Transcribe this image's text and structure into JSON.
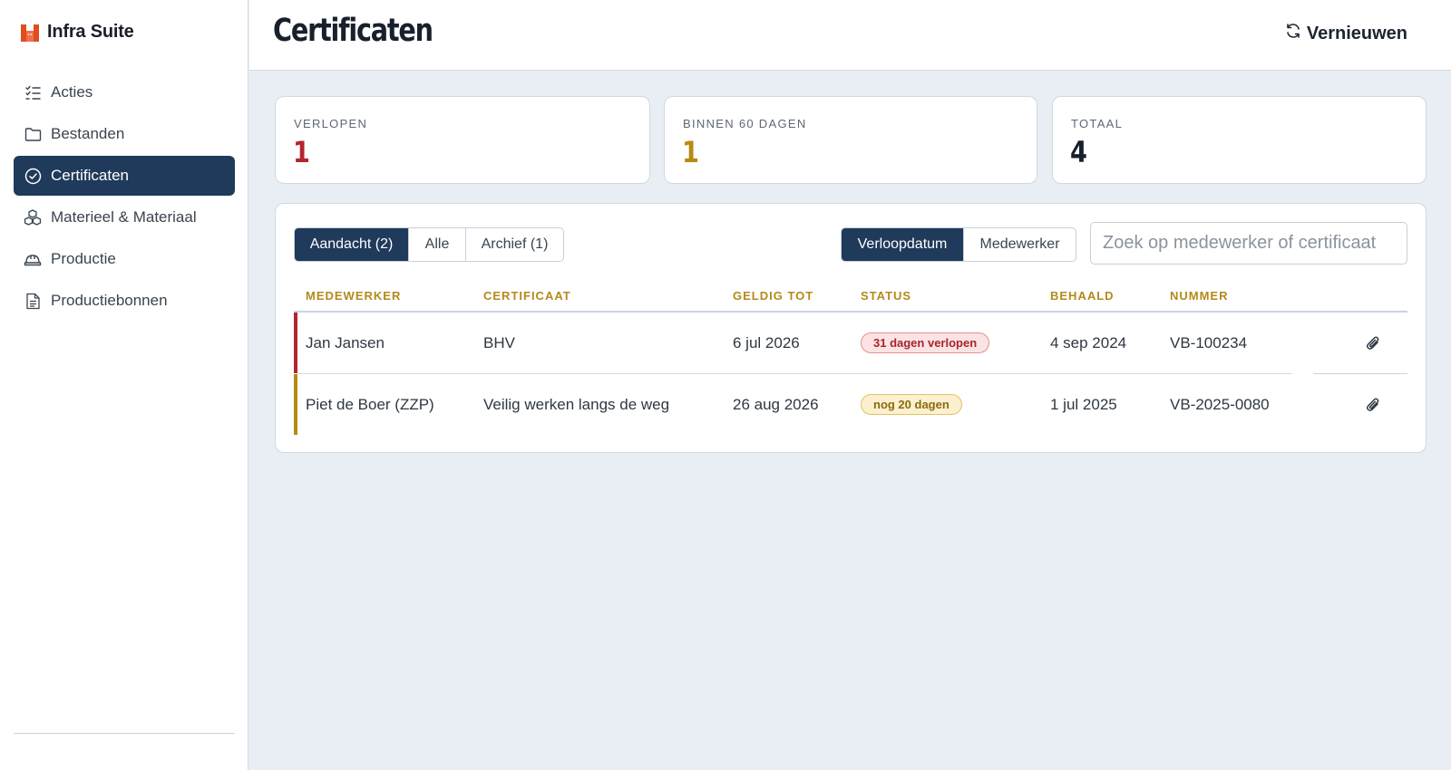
{
  "app": {
    "name": "Infra Suite",
    "brand_color": "#e04e1e"
  },
  "sidebar": {
    "items": [
      {
        "label": "Acties",
        "icon": "checklist-icon",
        "active": false
      },
      {
        "label": "Bestanden",
        "icon": "folder-icon",
        "active": false
      },
      {
        "label": "Certificaten",
        "icon": "check-circle-icon",
        "active": true
      },
      {
        "label": "Materieel & Materiaal",
        "icon": "boxes-icon",
        "active": false
      },
      {
        "label": "Productie",
        "icon": "hardhat-icon",
        "active": false
      },
      {
        "label": "Productiebonnen",
        "icon": "document-icon",
        "active": false
      }
    ]
  },
  "header": {
    "title": "Certificaten",
    "refresh_label": "Vernieuwen"
  },
  "stats": [
    {
      "label": "VERLOPEN",
      "value": "1",
      "color": "#b3262e"
    },
    {
      "label": "BINNEN 60 DAGEN",
      "value": "1",
      "color": "#b88a12"
    },
    {
      "label": "TOTAAL",
      "value": "4",
      "color": "#18202c"
    }
  ],
  "filters": {
    "tabs": [
      {
        "label": "Aandacht (2)",
        "active": true
      },
      {
        "label": "Alle",
        "active": false
      },
      {
        "label": "Archief (1)",
        "active": false
      }
    ],
    "sort": [
      {
        "label": "Verloopdatum",
        "active": true
      },
      {
        "label": "Medewerker",
        "active": false
      }
    ],
    "search_placeholder": "Zoek op medewerker of certificaat",
    "search_value": ""
  },
  "table": {
    "columns": [
      "MEDEWERKER",
      "CERTIFICAAT",
      "GELDIG TOT",
      "STATUS",
      "BEHAALD",
      "NUMMER"
    ],
    "rows": [
      {
        "medewerker": "Jan Jansen",
        "certificaat": "BHV",
        "geldig_tot": "6 jul 2026",
        "status": "31 dagen verlopen",
        "status_type": "expired",
        "behaald": "4 sep 2024",
        "nummer": "VB-100234",
        "accent": "#b3262e"
      },
      {
        "medewerker": "Piet de Boer (ZZP)",
        "certificaat": "Veilig werken langs de weg",
        "geldig_tot": "26 aug 2026",
        "status": "nog 20 dagen",
        "status_type": "soon",
        "behaald": "1 jul 2025",
        "nummer": "VB-2025-0080",
        "accent": "#b88a12"
      }
    ]
  },
  "colors": {
    "expired_badge_bg": "#fbe3e4",
    "expired_badge_border": "#e58f93",
    "expired_badge_text": "#a6262c",
    "soon_badge_bg": "#fbf0cf",
    "soon_badge_border": "#e0c267",
    "soon_badge_text": "#8c6a0f"
  }
}
